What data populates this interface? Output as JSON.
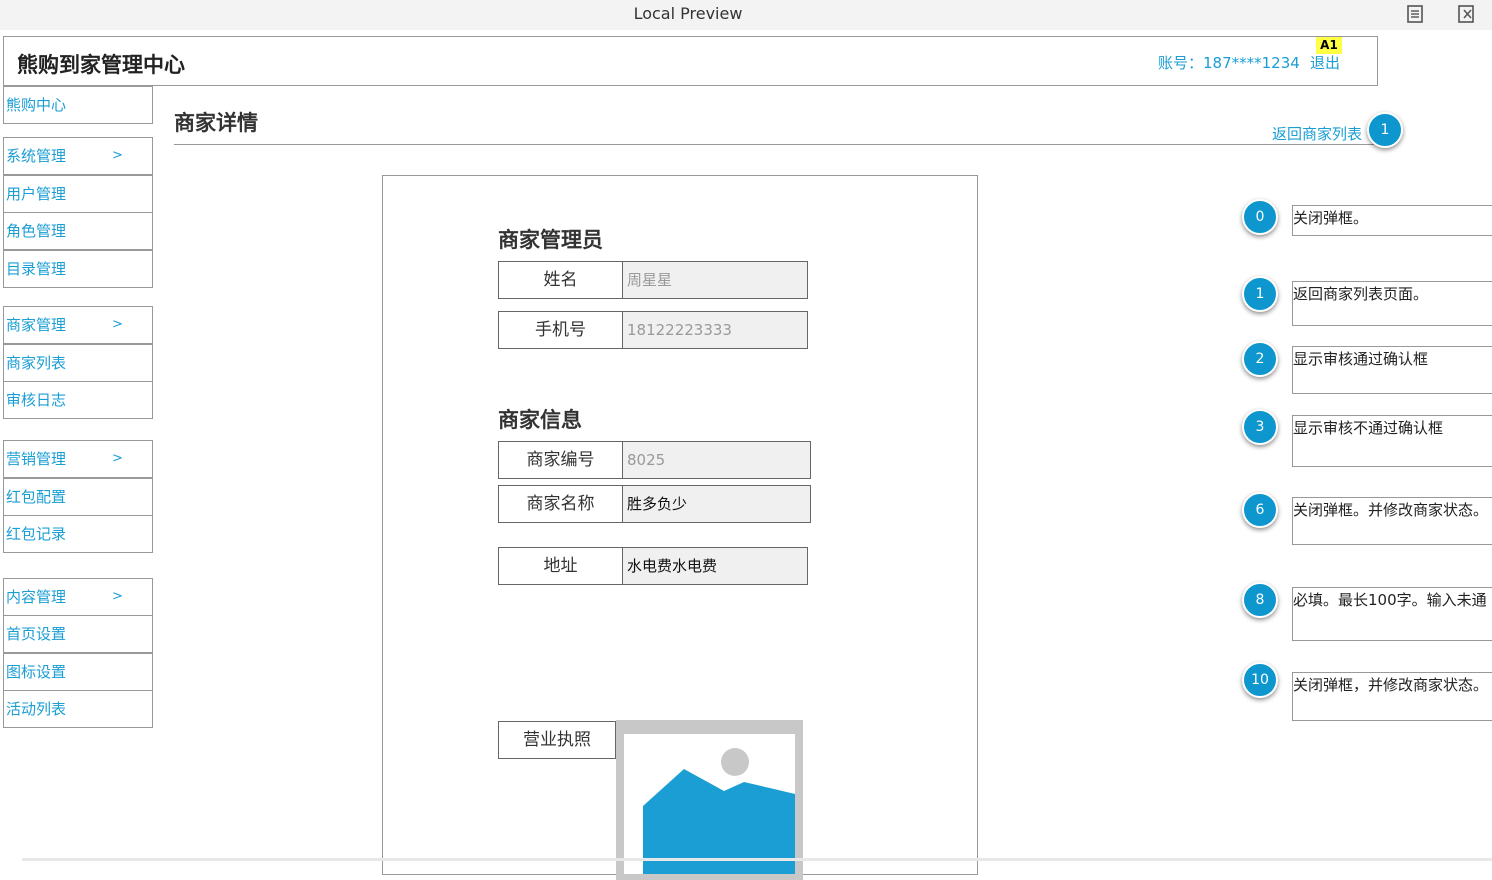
{
  "window": {
    "title": "Local Preview"
  },
  "header": {
    "app_title": "熊购到家管理中心",
    "account": "账号：187****1234",
    "logout": "退出",
    "badge": "A1"
  },
  "sidebar": {
    "items": [
      {
        "label": "熊购中心",
        "arrow": ""
      },
      {
        "label": "系统管理",
        "arrow": ">"
      },
      {
        "label": "用户管理",
        "arrow": ""
      },
      {
        "label": "角色管理",
        "arrow": ""
      },
      {
        "label": "目录管理",
        "arrow": ""
      },
      {
        "label": "商家管理",
        "arrow": ">"
      },
      {
        "label": "商家列表",
        "arrow": ""
      },
      {
        "label": "审核日志",
        "arrow": ""
      },
      {
        "label": "营销管理",
        "arrow": ">"
      },
      {
        "label": "红包配置",
        "arrow": ""
      },
      {
        "label": "红包记录",
        "arrow": ""
      },
      {
        "label": "内容管理",
        "arrow": ">"
      },
      {
        "label": "首页设置",
        "arrow": ""
      },
      {
        "label": "图标设置",
        "arrow": ""
      },
      {
        "label": "活动列表",
        "arrow": ""
      }
    ]
  },
  "main": {
    "page_title": "商家详情",
    "back_link": "返回商家列表",
    "back_marker": "1",
    "admin_section": {
      "title": "商家管理员",
      "fields": [
        {
          "label": "姓名",
          "value": "周星星"
        },
        {
          "label": "手机号",
          "value": "18122223333"
        }
      ]
    },
    "info_section": {
      "title": "商家信息",
      "fields": [
        {
          "label": "商家编号",
          "value": "8025"
        },
        {
          "label": "商家名称",
          "value": "胜多负少"
        },
        {
          "label": "地址",
          "value": "水电费水电费"
        }
      ]
    },
    "license_label": "营业执照",
    "license_image": "image-placeholder-icon"
  },
  "annotations": [
    {
      "num": "0",
      "text": "关闭弹框。"
    },
    {
      "num": "1",
      "text": "返回商家列表页面。"
    },
    {
      "num": "2",
      "text": "显示审核通过确认框"
    },
    {
      "num": "3",
      "text": "显示审核不通过确认框"
    },
    {
      "num": "6",
      "text": "关闭弹框。并修改商家状态。"
    },
    {
      "num": "8",
      "text": "必填。最长100字。输入未通"
    },
    {
      "num": "10",
      "text": "关闭弹框，并修改商家状态。"
    }
  ],
  "colors": {
    "accent": "#1a9ed4",
    "marker": "#0e96cf",
    "badge": "#ffff44",
    "image_blue": "#1a9ed4"
  }
}
